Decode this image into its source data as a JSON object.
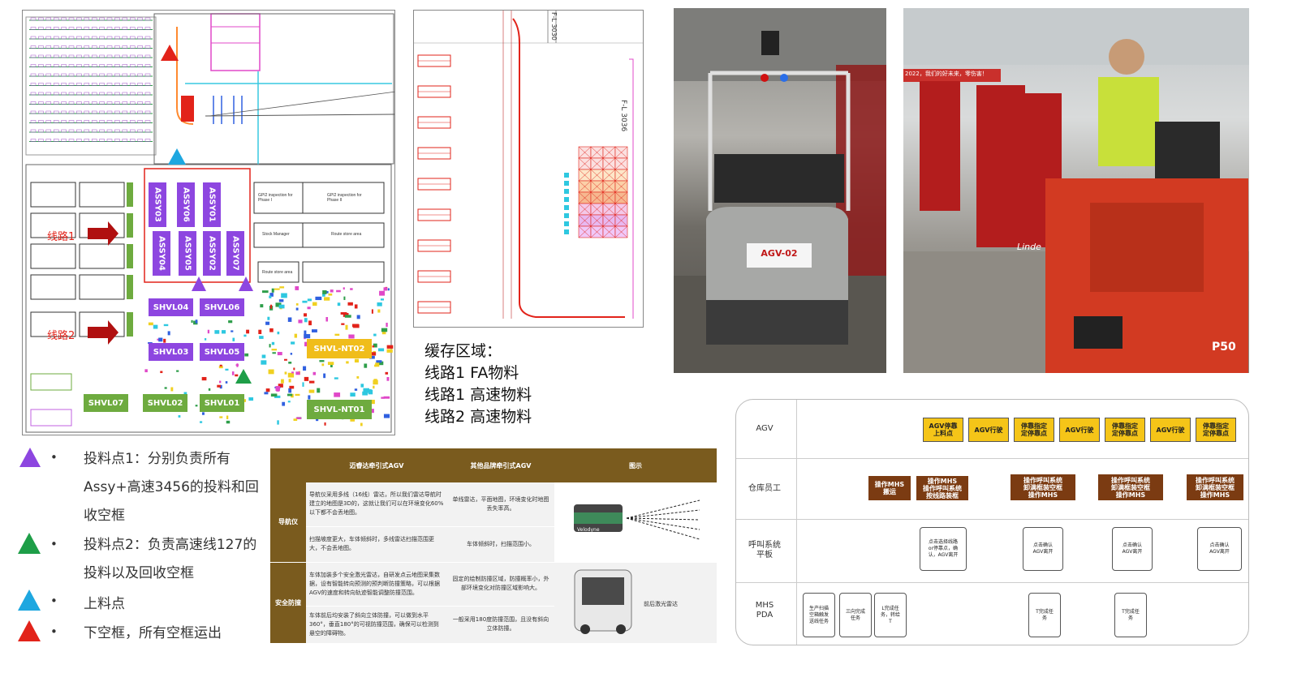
{
  "floorplan": {
    "bays": [
      "ASSY03",
      "ASSY06",
      "ASSY01",
      "ASSY04",
      "ASSY05",
      "ASSY02",
      "ASSY07"
    ],
    "shvl_purple": [
      "SHVL04",
      "SHVL06",
      "SHVL03",
      "SHVL05"
    ],
    "shvl_green": [
      "SHVL07",
      "SHVL02",
      "SHVL01"
    ],
    "shvl_yellow": [
      "SHVL-NT02",
      "SHVL-NT01"
    ],
    "route1": "线路1",
    "route2": "线路2",
    "rooms": [
      "GPI2 inspection for Phase I",
      "GPI2 inspection for Phase II",
      "Stock Manager",
      "Route store area",
      "Route store area"
    ],
    "colors": {
      "purple": "#8d46e0",
      "green": "#6eab3f",
      "yellow": "#f0bd1b",
      "red": "#e2231a",
      "cyan": "#1ea7e0"
    }
  },
  "zoomplan": {
    "label_top": "F-L 3030",
    "label_side": "F-L 3036"
  },
  "buffer": {
    "title": "缓存区域：",
    "line1": "线路1 FA物料",
    "line2": "线路1 高速物料",
    "line3": "线路2 高速物料"
  },
  "photo1": {
    "tag": "AGV-02"
  },
  "photo2": {
    "banner": "2022，我们的好未来，零伤害！",
    "brand": "Linde",
    "model": "P50"
  },
  "legend": [
    {
      "bullet": "•",
      "text": "投料点1：分别负责所有Assy+高速3456的投料和回收空框",
      "color": "#8d46e0"
    },
    {
      "bullet": "•",
      "text": "投料点2：负责高速线127的投料以及回收空框",
      "color": "#1e9e48"
    },
    {
      "bullet": "•",
      "text": "上料点",
      "color": "#1ea7e0"
    },
    {
      "bullet": "•",
      "text": "下空框，所有空框运出",
      "color": "#e2231a"
    }
  ],
  "compare": {
    "headers": [
      "",
      "迈睿达牵引式AGV",
      "其他品牌牵引式AGV",
      "图示"
    ],
    "sections": [
      {
        "name": "导航仪",
        "rows": [
          {
            "a": "导航仪采用多线（16线）雷达，所以我们雷达导航时建立的地图是3D的，这就让我们可以在环境变化60%以下都不会丢地图。",
            "b": "单线雷达，平面地图，环境变化时地图丢失率高。"
          },
          {
            "a": "扫描坡度更大，车体倾斜时，多线雷达扫描范围更大，不会丢地图。",
            "b": "车体倾斜时，扫描范围小。"
          }
        ],
        "caption": "Velodyne"
      },
      {
        "name": "安全防撞",
        "rows": [
          {
            "a": "车体加装多个安全激光雷达，自研发点云地图采集数据，设有智能转向预测的预判断防撞策略，可以根据AGV的速度和转向轨迹智能调整防撞范围。",
            "b": "固定的绘制防撞区域，防撞概率小，外部环境变化对防撞区域影响大。"
          },
          {
            "a": "车体前后均安装了斜向立体防撞，可以做到水平360°，垂直180°的可视防撞范围，确保可以检测到悬空的障碍物。",
            "b": "一般采用180度防撞范围，且没有斜向立体防撞。"
          }
        ],
        "caption": "前后激光雷达"
      }
    ]
  },
  "swim": {
    "lanes": [
      "AGV",
      "仓库员工",
      "呼叫系统\n平板",
      "MHS\nPDA"
    ],
    "agv_boxes": [
      "AGV停靠\n上料点",
      "AGV行驶",
      "停靠指定\n定停靠点",
      "AGV行驶",
      "停靠指定\n定停靠点",
      "AGV行驶",
      "停靠指定\n定停靠点"
    ],
    "staff_boxes": [
      "操作MHS\n搬运",
      "操作MHS\n操作呼叫系统\n按线路装框",
      "操作呼叫系统\n卸满框装空框\n操作MHS",
      "操作呼叫系统\n卸满框装空框\n操作MHS",
      "操作呼叫系统\n卸满框装空框\n操作MHS"
    ],
    "tablet_boxes": [
      "点击选择线路\nor停靠点，确\n认，AGV离开",
      "点击确认\nAGV离开",
      "点击确认\nAGV离开",
      "点击确认\nAGV离开"
    ],
    "pda_boxes": [
      "生产扫描\n空箱触发\n送线任务",
      "三向完成\n任务",
      "L完成任\n务，转给\nT",
      "T完成任\n务",
      "T完成任\n务"
    ]
  }
}
